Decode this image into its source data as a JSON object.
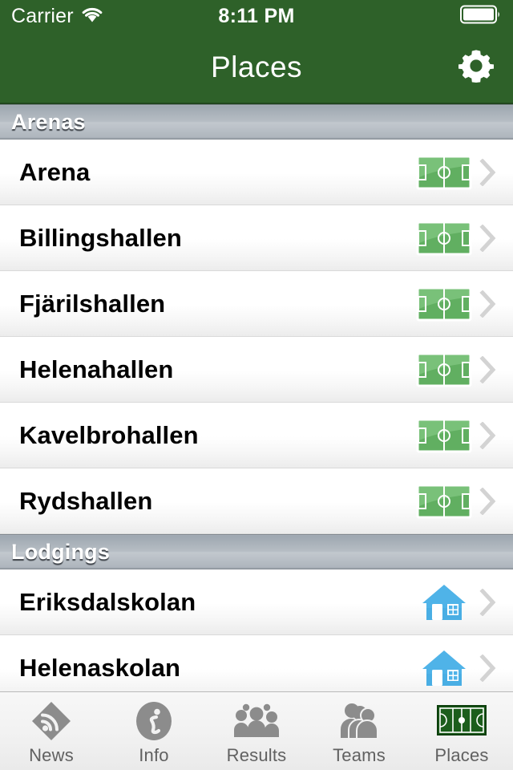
{
  "status_bar": {
    "carrier": "Carrier",
    "wifi_icon": "wifi-icon",
    "time": "8:11 PM",
    "battery_icon": "battery-full-icon"
  },
  "nav_bar": {
    "title": "Places",
    "right_button_icon": "gear-icon"
  },
  "colors": {
    "nav_green": "#2e6129",
    "pitch_green": "#5fad5f",
    "tab_pitch_green": "#1c5e1c",
    "house_blue": "#4fb3e8",
    "tab_gray": "#8c8c8c",
    "row_text": "#010101"
  },
  "sections": [
    {
      "title": "Arenas",
      "rows": [
        {
          "label": "Arena",
          "icon": "soccer-field-icon",
          "accessory": "chevron-right-icon"
        },
        {
          "label": "Billingshallen",
          "icon": "soccer-field-icon",
          "accessory": "chevron-right-icon"
        },
        {
          "label": "Fjärilshallen",
          "icon": "soccer-field-icon",
          "accessory": "chevron-right-icon"
        },
        {
          "label": "Helenahallen",
          "icon": "soccer-field-icon",
          "accessory": "chevron-right-icon"
        },
        {
          "label": "Kavelbrohallen",
          "icon": "soccer-field-icon",
          "accessory": "chevron-right-icon"
        },
        {
          "label": "Rydshallen",
          "icon": "soccer-field-icon",
          "accessory": "chevron-right-icon"
        }
      ]
    },
    {
      "title": "Lodgings",
      "rows": [
        {
          "label": "Eriksdalskolan",
          "icon": "house-icon",
          "accessory": "chevron-right-icon"
        },
        {
          "label": "Helenaskolan",
          "icon": "house-icon",
          "accessory": "chevron-right-icon"
        }
      ]
    }
  ],
  "tab_bar": {
    "selected": "Places",
    "tabs": [
      {
        "label": "News",
        "icon": "rss-icon"
      },
      {
        "label": "Info",
        "icon": "info-circle-icon"
      },
      {
        "label": "Results",
        "icon": "people-group-icon"
      },
      {
        "label": "Teams",
        "icon": "people-stack-icon"
      },
      {
        "label": "Places",
        "icon": "field-icon"
      }
    ]
  }
}
